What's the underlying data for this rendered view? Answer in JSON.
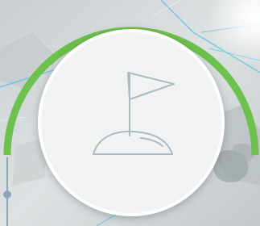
{
  "colors": {
    "arc_green": "#6cc24a",
    "badge_fill": "#f1f3f3",
    "badge_border": "#ffffff",
    "icon_stroke": "#a9bcc4",
    "map_background": "#d6dbdc",
    "map_roads": "#5cc6e6",
    "connector": "#8aa8b8"
  },
  "icons": {
    "badge_icon": "golf-flag-icon",
    "connector_dot": "node-dot-icon"
  }
}
